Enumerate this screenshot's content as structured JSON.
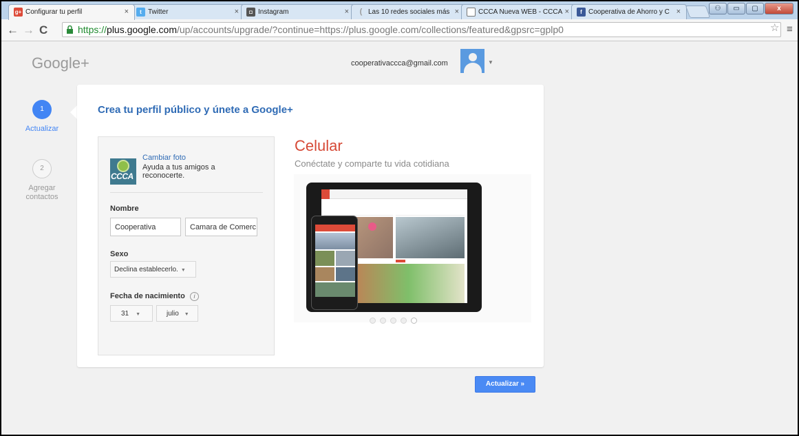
{
  "browser": {
    "tabs": [
      {
        "label": "Configurar tu perfil",
        "favicon": "google-plus-icon",
        "color": "#dd4b39",
        "active": true
      },
      {
        "label": "Twitter",
        "favicon": "twitter-icon",
        "color": "#55acee"
      },
      {
        "label": "Instagram",
        "favicon": "instagram-icon",
        "color": "#555555"
      },
      {
        "label": "Las 10 redes sociales más",
        "favicon": "loading-icon",
        "color": "#999999"
      },
      {
        "label": "CCCA Nueva WEB - CCCA",
        "favicon": "document-icon",
        "color": "#666666"
      },
      {
        "label": "Cooperativa de Ahorro y C",
        "favicon": "facebook-icon",
        "color": "#3b5998"
      }
    ],
    "url": {
      "protocol": "https://",
      "host": "plus.google.com",
      "path": "/up/accounts/upgrade/?continue=https://plus.google.com/collections/featured&gpsrc=gplp0"
    },
    "window_buttons": {
      "minimize": "▭",
      "maximize": "▢",
      "close": "x"
    }
  },
  "header": {
    "logo": "Google+",
    "email": "cooperativaccca@gmail.com"
  },
  "steps": [
    {
      "number": "1",
      "label": "Actualizar"
    },
    {
      "number": "2",
      "label_line1": "Agregar",
      "label_line2": "contactos"
    }
  ],
  "card": {
    "title": "Crea tu perfil público y únete a Google+",
    "profile": {
      "photo_text": "CCCA",
      "change_photo": "Cambiar foto",
      "help_text": "Ayuda a tus amigos a reconocerte."
    },
    "form": {
      "name_label": "Nombre",
      "first_name": "Cooperativa",
      "last_name": "Camara de Comerc",
      "gender_label": "Sexo",
      "gender_value": "Declina establecerlo.",
      "birthdate_label": "Fecha de nacimiento",
      "info_icon": "i",
      "birth_day": "31",
      "birth_month": "julio"
    },
    "promo": {
      "title": "Celular",
      "subtitle": "Conéctate y comparte tu vida cotidiana",
      "carousel_count": 5,
      "carousel_active": 5
    }
  },
  "actions": {
    "update_button": "Actualizar »"
  },
  "colors": {
    "accent_blue": "#4285f4",
    "title_blue": "#2f6bb5",
    "promo_red": "#d64936"
  }
}
